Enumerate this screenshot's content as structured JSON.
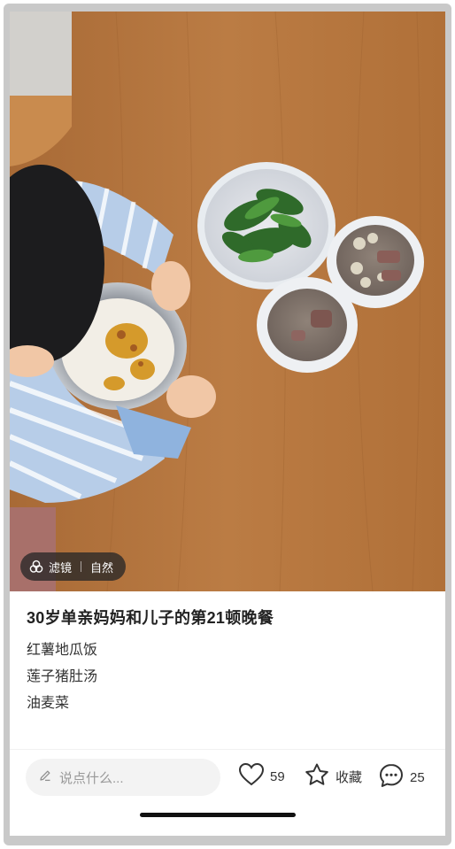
{
  "photo": {
    "filter_chip": {
      "icon": "filter-icon",
      "label": "滤镜",
      "value": "自然"
    }
  },
  "post": {
    "title": "30岁单亲妈妈和儿子的第21顿晚餐",
    "lines": [
      "红薯地瓜饭",
      "莲子猪肚汤",
      "油麦菜"
    ]
  },
  "bottom_bar": {
    "comment_placeholder": "说点什么...",
    "likes": "59",
    "favorite_label": "收藏",
    "comments": "25"
  },
  "colors": {
    "table": "#b8773f",
    "accent_text": "#222222"
  }
}
